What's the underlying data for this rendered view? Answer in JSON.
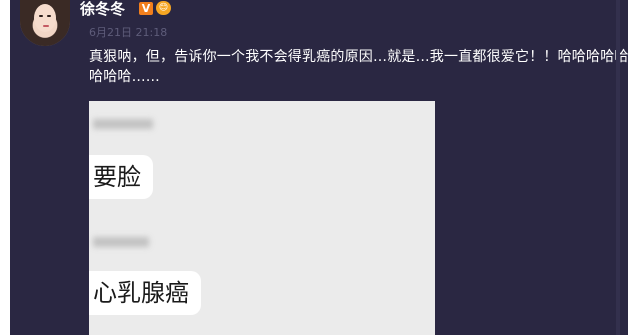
{
  "post": {
    "username": "徐冬冬",
    "verified_badge": "V",
    "level_badge": "😊",
    "timestamp": "6月21日 21:18",
    "text": "真狠呐，但，告诉你一个我不会得乳癌的原因…就是…我一直都很爱它！！哈哈哈哈哈哈哈哈……"
  },
  "image": {
    "bubbles": [
      {
        "text": "要脸"
      },
      {
        "text": "心乳腺癌"
      }
    ]
  },
  "colors": {
    "post_background": "#2a2742",
    "username": "#ffffff",
    "timestamp": "#5e5c7a",
    "verified_badge": "#f27f1d",
    "image_background": "#ebebeb"
  }
}
